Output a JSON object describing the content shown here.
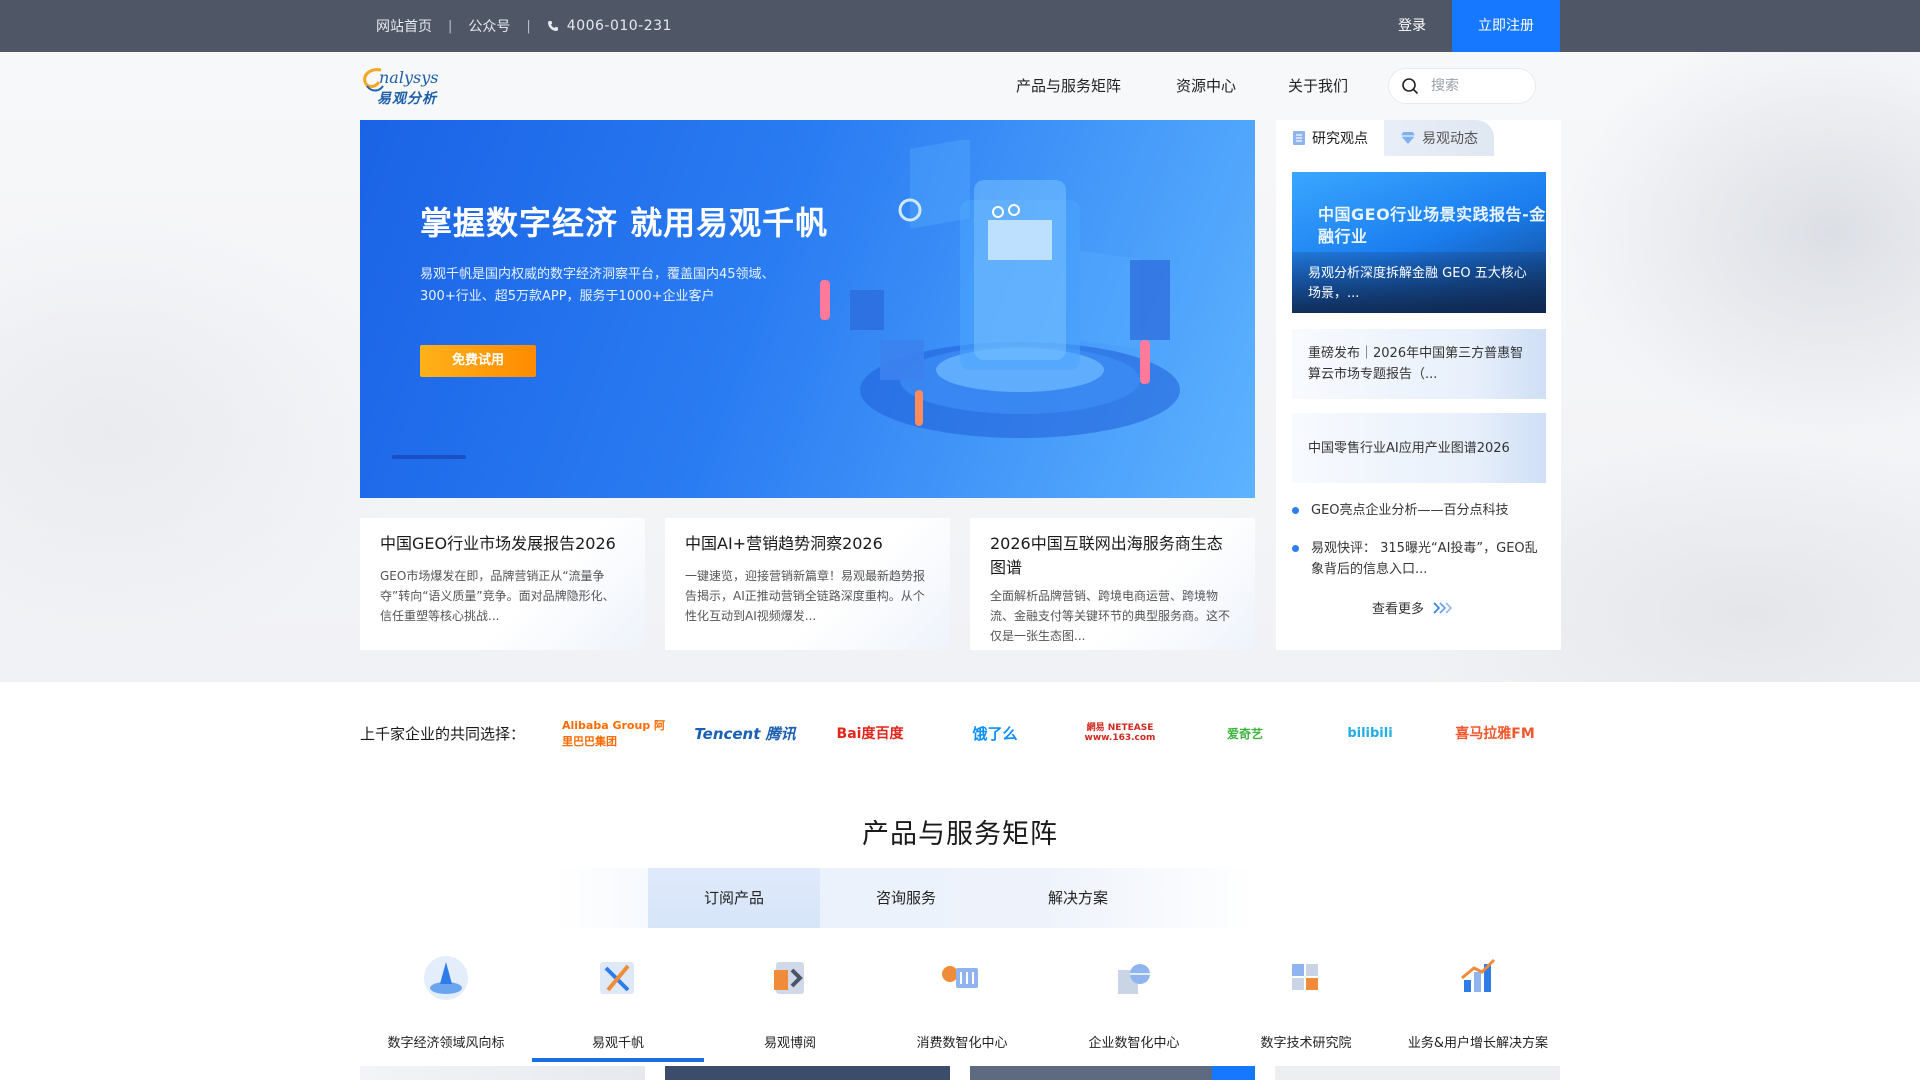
{
  "topbar": {
    "home": "网站首页",
    "official_account": "公众号",
    "phone": "4006-010-231",
    "login": "登录",
    "register": "立即注册"
  },
  "logo": {
    "en": "nalysys",
    "zh": "易观分析"
  },
  "nav": {
    "items": [
      "产品与服务矩阵",
      "资源中心",
      "关于我们"
    ],
    "search_placeholder": "搜索"
  },
  "banner": {
    "headline": "掌握数字经济  就用易观千帆",
    "description": "易观千帆是国内权威的数字经济洞察平台，覆盖国内45领域、300+行业、超5万款APP，服务于1000+企业客户",
    "cta": "免费试用"
  },
  "cards": [
    {
      "title": "中国GEO行业市场发展报告2026",
      "desc": "GEO市场爆发在即，品牌营销正从“流量争夺”转向“语义质量”竞争。面对品牌隐形化、信任重塑等核心挑战..."
    },
    {
      "title": "中国AI+营销趋势洞察2026",
      "desc": "一键速览，迎接营销新篇章！易观最新趋势报告揭示，AI正推动营销全链路深度重构。从个性化互动到AI视频爆发..."
    },
    {
      "title": "2026中国互联网出海服务商生态图谱",
      "desc": "全面解析品牌营销、跨境电商运营、跨境物流、金融支付等关键环节的典型服务商。这不仅是一张生态图..."
    }
  ],
  "side": {
    "tab_research": "研究观点",
    "tab_news": "易观动态",
    "featured_banner_text": "中国GEO行业场景实践报告-金融行业",
    "featured_caption": "易观分析深度拆解金融 GEO 五大核心场景，...",
    "news": [
      "重磅发布｜2026年中国第三方普惠智算云市场专题报告（...",
      "中国零售行业AI应用产业图谱2026"
    ],
    "bullets": [
      "GEO亮点企业分析——百分点科技",
      "易观快评： 315曝光“AI投毒”，GEO乱象背后的信息入口..."
    ],
    "more": "查看更多"
  },
  "partners": {
    "label": "上千家企业的共同选择：",
    "logos": [
      "Alibaba Group 阿里巴巴集团",
      "Tencent 腾讯",
      "Bai度百度",
      "饿了么",
      "網易 NETEASE www.163.com",
      "爱奇艺",
      "bilibili",
      "喜马拉雅FM"
    ]
  },
  "products": {
    "title": "产品与服务矩阵",
    "tabs": [
      "订阅产品",
      "咨询服务",
      "解决方案"
    ],
    "active_tab": "订阅产品",
    "items": [
      "数字经济领域风向标",
      "易观千帆",
      "易观博阅",
      "消费数智化中心",
      "企业数智化中心",
      "数字技术研究院",
      "业务&用户增长解决方案"
    ],
    "active_item": "易观千帆"
  },
  "colors": {
    "topbar": "#4f5767",
    "accent": "#1677ff",
    "cta": "#ff8a00"
  }
}
